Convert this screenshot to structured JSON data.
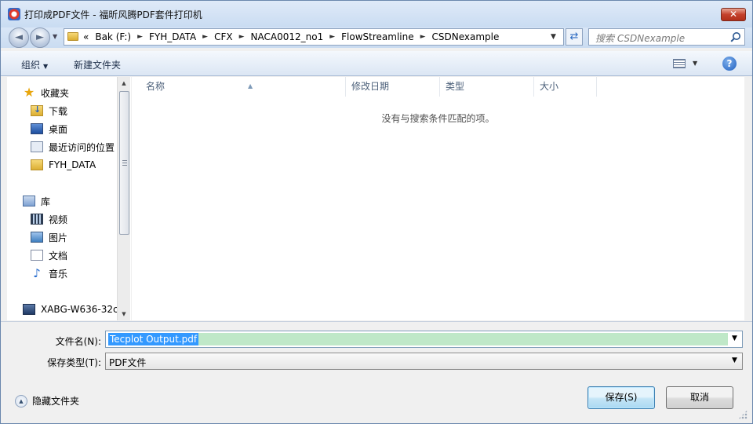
{
  "window": {
    "title": "打印成PDF文件 - 福昕风腾PDF套件打印机",
    "close_label": "✕"
  },
  "nav": {
    "back_label": "◄",
    "forward_label": "►"
  },
  "address": {
    "overflow": "«",
    "segments": [
      "Bak (F:)",
      "FYH_DATA",
      "CFX",
      "NACA0012_no1",
      "FlowStreamline",
      "CSDNexample"
    ]
  },
  "search": {
    "placeholder": "搜索 CSDNexample"
  },
  "toolbar": {
    "organize_label": "组织",
    "new_folder_label": "新建文件夹",
    "help_label": "?"
  },
  "sidebar": {
    "items": [
      {
        "label": "收藏夹",
        "icon": "star-icon"
      },
      {
        "label": "下载",
        "icon": "downloads-folder-icon"
      },
      {
        "label": "桌面",
        "icon": "desktop-icon"
      },
      {
        "label": "最近访问的位置",
        "icon": "recent-places-icon"
      },
      {
        "label": "FYH_DATA",
        "icon": "folder-icon"
      },
      {
        "label": "库",
        "icon": "library-icon"
      },
      {
        "label": "视频",
        "icon": "video-icon"
      },
      {
        "label": "图片",
        "icon": "pictures-icon"
      },
      {
        "label": "文档",
        "icon": "documents-icon"
      },
      {
        "label": "音乐",
        "icon": "music-icon"
      },
      {
        "label": "XABG-W636-32c",
        "icon": "computer-icon"
      }
    ]
  },
  "files": {
    "columns": [
      "名称",
      "修改日期",
      "类型",
      "大小"
    ],
    "empty_message": "没有与搜索条件匹配的项。"
  },
  "form": {
    "filename_label": "文件名(N):",
    "filename_value": "Tecplot Output.pdf",
    "filetype_label": "保存类型(T):",
    "filetype_value": "PDF文件"
  },
  "footer": {
    "hide_folders_label": "隐藏文件夹",
    "save_label": "保存(S)",
    "cancel_label": "取消"
  },
  "colors": {
    "titlebar": "#c9dcf2",
    "selection": "#3399ff",
    "filename_highlight": "#bfe8c8",
    "save_button": "#c4e5f6"
  }
}
